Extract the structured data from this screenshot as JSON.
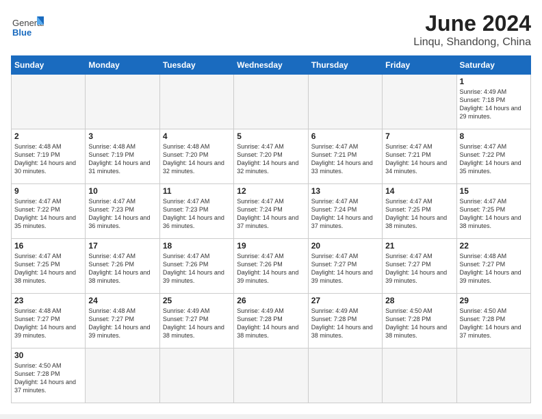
{
  "header": {
    "logo_general": "General",
    "logo_blue": "Blue",
    "title": "June 2024",
    "subtitle": "Linqu, Shandong, China"
  },
  "weekdays": [
    "Sunday",
    "Monday",
    "Tuesday",
    "Wednesday",
    "Thursday",
    "Friday",
    "Saturday"
  ],
  "weeks": [
    [
      {
        "day": "",
        "info": ""
      },
      {
        "day": "",
        "info": ""
      },
      {
        "day": "",
        "info": ""
      },
      {
        "day": "",
        "info": ""
      },
      {
        "day": "",
        "info": ""
      },
      {
        "day": "",
        "info": ""
      },
      {
        "day": "1",
        "info": "Sunrise: 4:49 AM\nSunset: 7:18 PM\nDaylight: 14 hours and 29 minutes."
      }
    ],
    [
      {
        "day": "2",
        "info": "Sunrise: 4:48 AM\nSunset: 7:19 PM\nDaylight: 14 hours and 30 minutes."
      },
      {
        "day": "3",
        "info": "Sunrise: 4:48 AM\nSunset: 7:19 PM\nDaylight: 14 hours and 31 minutes."
      },
      {
        "day": "4",
        "info": "Sunrise: 4:48 AM\nSunset: 7:20 PM\nDaylight: 14 hours and 32 minutes."
      },
      {
        "day": "5",
        "info": "Sunrise: 4:47 AM\nSunset: 7:20 PM\nDaylight: 14 hours and 32 minutes."
      },
      {
        "day": "6",
        "info": "Sunrise: 4:47 AM\nSunset: 7:21 PM\nDaylight: 14 hours and 33 minutes."
      },
      {
        "day": "7",
        "info": "Sunrise: 4:47 AM\nSunset: 7:21 PM\nDaylight: 14 hours and 34 minutes."
      },
      {
        "day": "8",
        "info": "Sunrise: 4:47 AM\nSunset: 7:22 PM\nDaylight: 14 hours and 35 minutes."
      }
    ],
    [
      {
        "day": "9",
        "info": "Sunrise: 4:47 AM\nSunset: 7:22 PM\nDaylight: 14 hours and 35 minutes."
      },
      {
        "day": "10",
        "info": "Sunrise: 4:47 AM\nSunset: 7:23 PM\nDaylight: 14 hours and 36 minutes."
      },
      {
        "day": "11",
        "info": "Sunrise: 4:47 AM\nSunset: 7:23 PM\nDaylight: 14 hours and 36 minutes."
      },
      {
        "day": "12",
        "info": "Sunrise: 4:47 AM\nSunset: 7:24 PM\nDaylight: 14 hours and 37 minutes."
      },
      {
        "day": "13",
        "info": "Sunrise: 4:47 AM\nSunset: 7:24 PM\nDaylight: 14 hours and 37 minutes."
      },
      {
        "day": "14",
        "info": "Sunrise: 4:47 AM\nSunset: 7:25 PM\nDaylight: 14 hours and 38 minutes."
      },
      {
        "day": "15",
        "info": "Sunrise: 4:47 AM\nSunset: 7:25 PM\nDaylight: 14 hours and 38 minutes."
      }
    ],
    [
      {
        "day": "16",
        "info": "Sunrise: 4:47 AM\nSunset: 7:25 PM\nDaylight: 14 hours and 38 minutes."
      },
      {
        "day": "17",
        "info": "Sunrise: 4:47 AM\nSunset: 7:26 PM\nDaylight: 14 hours and 38 minutes."
      },
      {
        "day": "18",
        "info": "Sunrise: 4:47 AM\nSunset: 7:26 PM\nDaylight: 14 hours and 39 minutes."
      },
      {
        "day": "19",
        "info": "Sunrise: 4:47 AM\nSunset: 7:26 PM\nDaylight: 14 hours and 39 minutes."
      },
      {
        "day": "20",
        "info": "Sunrise: 4:47 AM\nSunset: 7:27 PM\nDaylight: 14 hours and 39 minutes."
      },
      {
        "day": "21",
        "info": "Sunrise: 4:47 AM\nSunset: 7:27 PM\nDaylight: 14 hours and 39 minutes."
      },
      {
        "day": "22",
        "info": "Sunrise: 4:48 AM\nSunset: 7:27 PM\nDaylight: 14 hours and 39 minutes."
      }
    ],
    [
      {
        "day": "23",
        "info": "Sunrise: 4:48 AM\nSunset: 7:27 PM\nDaylight: 14 hours and 39 minutes."
      },
      {
        "day": "24",
        "info": "Sunrise: 4:48 AM\nSunset: 7:27 PM\nDaylight: 14 hours and 39 minutes."
      },
      {
        "day": "25",
        "info": "Sunrise: 4:49 AM\nSunset: 7:27 PM\nDaylight: 14 hours and 38 minutes."
      },
      {
        "day": "26",
        "info": "Sunrise: 4:49 AM\nSunset: 7:28 PM\nDaylight: 14 hours and 38 minutes."
      },
      {
        "day": "27",
        "info": "Sunrise: 4:49 AM\nSunset: 7:28 PM\nDaylight: 14 hours and 38 minutes."
      },
      {
        "day": "28",
        "info": "Sunrise: 4:50 AM\nSunset: 7:28 PM\nDaylight: 14 hours and 38 minutes."
      },
      {
        "day": "29",
        "info": "Sunrise: 4:50 AM\nSunset: 7:28 PM\nDaylight: 14 hours and 37 minutes."
      }
    ],
    [
      {
        "day": "30",
        "info": "Sunrise: 4:50 AM\nSunset: 7:28 PM\nDaylight: 14 hours and 37 minutes."
      },
      {
        "day": "",
        "info": ""
      },
      {
        "day": "",
        "info": ""
      },
      {
        "day": "",
        "info": ""
      },
      {
        "day": "",
        "info": ""
      },
      {
        "day": "",
        "info": ""
      },
      {
        "day": "",
        "info": ""
      }
    ]
  ]
}
